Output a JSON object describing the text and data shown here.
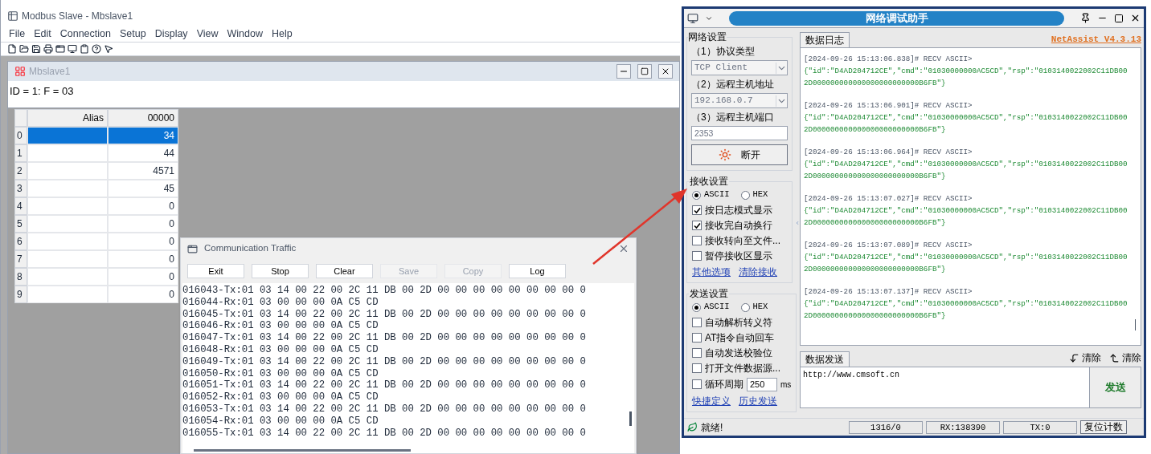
{
  "modbus": {
    "title": "Modbus Slave - Mbslave1",
    "menu": [
      "File",
      "Edit",
      "Connection",
      "Setup",
      "Display",
      "View",
      "Window",
      "Help"
    ],
    "child": {
      "title": "Mbslave1",
      "header": "ID = 1: F = 03",
      "columns": [
        "Alias",
        "00000"
      ],
      "rows": [
        {
          "index": "0",
          "value": "34",
          "selected": true
        },
        {
          "index": "1",
          "value": "44",
          "selected": false
        },
        {
          "index": "2",
          "value": "4571",
          "selected": false
        },
        {
          "index": "3",
          "value": "45",
          "selected": false
        },
        {
          "index": "4",
          "value": "0",
          "selected": false
        },
        {
          "index": "5",
          "value": "0",
          "selected": false
        },
        {
          "index": "6",
          "value": "0",
          "selected": false
        },
        {
          "index": "7",
          "value": "0",
          "selected": false
        },
        {
          "index": "8",
          "value": "0",
          "selected": false
        },
        {
          "index": "9",
          "value": "0",
          "selected": false
        }
      ]
    }
  },
  "traffic": {
    "title": "Communication Traffic",
    "buttons": [
      {
        "label": "Exit",
        "disabled": false
      },
      {
        "label": "Stop",
        "disabled": false
      },
      {
        "label": "Clear",
        "disabled": false
      },
      {
        "label": "Save",
        "disabled": true
      },
      {
        "label": "Copy",
        "disabled": true
      },
      {
        "label": "Log",
        "disabled": false
      }
    ],
    "lines": [
      "016043-Tx:01 03 14 00 22 00 2C 11 DB 00 2D 00 00 00 00 00 00 00 00 0",
      "016044-Rx:01 03 00 00 00 0A C5 CD",
      "016045-Tx:01 03 14 00 22 00 2C 11 DB 00 2D 00 00 00 00 00 00 00 00 0",
      "016046-Rx:01 03 00 00 00 0A C5 CD",
      "016047-Tx:01 03 14 00 22 00 2C 11 DB 00 2D 00 00 00 00 00 00 00 00 0",
      "016048-Rx:01 03 00 00 00 0A C5 CD",
      "016049-Tx:01 03 14 00 22 00 2C 11 DB 00 2D 00 00 00 00 00 00 00 00 0",
      "016050-Rx:01 03 00 00 00 0A C5 CD",
      "016051-Tx:01 03 14 00 22 00 2C 11 DB 00 2D 00 00 00 00 00 00 00 00 0",
      "016052-Rx:01 03 00 00 00 0A C5 CD",
      "016053-Tx:01 03 14 00 22 00 2C 11 DB 00 2D 00 00 00 00 00 00 00 00 0",
      "016054-Rx:01 03 00 00 00 0A C5 CD",
      "016055-Tx:01 03 14 00 22 00 2C 11 DB 00 2D 00 00 00 00 00 00 00 00 0"
    ]
  },
  "netassist": {
    "title": "网络调试助手",
    "network": {
      "legend": "网络设置",
      "protocol_label": "（1）协议类型",
      "protocol": "TCP Client",
      "host_label": "（2）远程主机地址",
      "host": "192.168.0.7",
      "port_label": "（3）远程主机端口",
      "port": "2353",
      "connect_button": "断开"
    },
    "receive": {
      "legend": "接收设置",
      "radios": [
        {
          "label": "ASCII",
          "selected": true
        },
        {
          "label": "HEX",
          "selected": false
        }
      ],
      "options": [
        {
          "kind": "check",
          "label": "按日志模式显示",
          "checked": true
        },
        {
          "kind": "check",
          "label": "接收完自动换行",
          "checked": true
        },
        {
          "kind": "check",
          "label": "接收转向至文件...",
          "checked": false
        },
        {
          "kind": "check",
          "label": "暂停接收区显示",
          "checked": false
        }
      ],
      "links": [
        "其他选项",
        "清除接收"
      ]
    },
    "send": {
      "legend": "发送设置",
      "radios": [
        {
          "label": "ASCII",
          "selected": true
        },
        {
          "label": "HEX",
          "selected": false
        }
      ],
      "options": [
        {
          "kind": "check",
          "label": "自动解析转义符",
          "checked": false
        },
        {
          "kind": "check",
          "label": "AT指令自动回车",
          "checked": false
        },
        {
          "kind": "check",
          "label": "自动发送校验位",
          "checked": false
        },
        {
          "kind": "check",
          "label": "打开文件数据源...",
          "checked": false
        },
        {
          "kind": "period",
          "label": "循环周期",
          "checked": false,
          "value": "250",
          "unit": "ms"
        }
      ],
      "links": [
        "快捷定义",
        "历史发送"
      ]
    },
    "log_tab": "数据日志",
    "version": "NetAssist V4.3.13",
    "log": [
      {
        "header": "[2024-09-26 15:13:06.838]# RECV ASCII>",
        "lines": [
          "{\"id\":\"D4AD204712CE\",\"cmd\":\"01030000000AC5CD\",\"rsp\":\"0103140022002C11DB00",
          "2D000000000000000000000000B6FB\"}"
        ]
      },
      {
        "header": "[2024-09-26 15:13:06.901]# RECV ASCII>",
        "lines": [
          "{\"id\":\"D4AD204712CE\",\"cmd\":\"01030000000AC5CD\",\"rsp\":\"0103140022002C11DB00",
          "2D000000000000000000000000B6FB\"}"
        ]
      },
      {
        "header": "[2024-09-26 15:13:06.964]# RECV ASCII>",
        "lines": [
          "{\"id\":\"D4AD204712CE\",\"cmd\":\"01030000000AC5CD\",\"rsp\":\"0103140022002C11DB00",
          "2D000000000000000000000000B6FB\"}"
        ]
      },
      {
        "header": "[2024-09-26 15:13:07.027]# RECV ASCII>",
        "lines": [
          "{\"id\":\"D4AD204712CE\",\"cmd\":\"01030000000AC5CD\",\"rsp\":\"0103140022002C11DB00",
          "2D000000000000000000000000B6FB\"}"
        ]
      },
      {
        "header": "[2024-09-26 15:13:07.089]# RECV ASCII>",
        "lines": [
          "{\"id\":\"D4AD204712CE\",\"cmd\":\"01030000000AC5CD\",\"rsp\":\"0103140022002C11DB00",
          "2D000000000000000000000000B6FB\"}"
        ]
      },
      {
        "header": "[2024-09-26 15:13:07.137]# RECV ASCII>",
        "lines": [
          "{\"id\":\"D4AD204712CE\",\"cmd\":\"01030000000AC5CD\",\"rsp\":\"0103140022002C11DB00",
          "2D000000000000000000000000B6FB\"}"
        ]
      }
    ],
    "send_tab": "数据发送",
    "clear_buttons": [
      "清除",
      "清除"
    ],
    "send_text": "http://www.cmsoft.cn",
    "send_button": "发送",
    "status": {
      "text": "就绪!",
      "cells": [
        "1316/0",
        "RX:138390",
        "TX:0"
      ],
      "reset_button": "复位计数"
    }
  }
}
